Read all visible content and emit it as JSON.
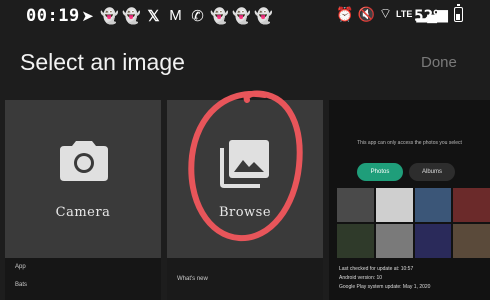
{
  "status": {
    "time": "00:19",
    "battery_pct": "52%",
    "battery_level": 0.52,
    "left_icons": [
      "telegram-icon",
      "ghost-icon",
      "ghost-icon",
      "x-icon",
      "gmail-icon",
      "whatsapp-icon",
      "ghost-icon",
      "ghost-icon",
      "ghost-icon"
    ],
    "right_icons": [
      "alarm-icon",
      "mute-icon",
      "wifi-icon",
      "lte-icon",
      "signal-icon"
    ],
    "lte": "LTE"
  },
  "header": {
    "title": "Select an image",
    "done": "Done"
  },
  "tiles": {
    "camera": "Camera",
    "browse": "Browse"
  },
  "annotation": {
    "color": "#e8555a"
  },
  "preview": {
    "message": "This app can only access the photos you select",
    "tab_photos": "Photos",
    "tab_albums": "Albums",
    "line1": "Last checked for update at: 10:57",
    "line2": "Android version: 10",
    "line3": "Google Play system update: May 1, 2020"
  },
  "below": {
    "row1": "App",
    "row2": "Bats",
    "whats_new": "What's new"
  }
}
